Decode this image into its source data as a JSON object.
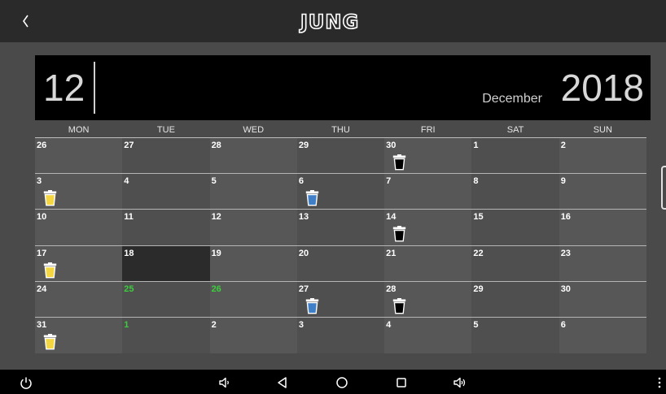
{
  "app": {
    "logo_text": "JUNG"
  },
  "header": {
    "day": "12",
    "month": "December",
    "year": "2018"
  },
  "weekdays": [
    "MON",
    "TUE",
    "WED",
    "THU",
    "FRI",
    "SAT",
    "SUN"
  ],
  "colors": {
    "bin_yellow": "#f3d641",
    "bin_blue": "#3f7fc8",
    "bin_black": "#000000",
    "holiday_green": "#3dcc3d"
  },
  "weeks": [
    [
      {
        "d": "26"
      },
      {
        "d": "27"
      },
      {
        "d": "28"
      },
      {
        "d": "29"
      },
      {
        "d": "30",
        "bin": "black"
      },
      {
        "d": "1"
      },
      {
        "d": "2"
      }
    ],
    [
      {
        "d": "3",
        "bin": "yellow"
      },
      {
        "d": "4"
      },
      {
        "d": "5"
      },
      {
        "d": "6",
        "bin": "blue"
      },
      {
        "d": "7"
      },
      {
        "d": "8"
      },
      {
        "d": "9"
      }
    ],
    [
      {
        "d": "10"
      },
      {
        "d": "11"
      },
      {
        "d": "12"
      },
      {
        "d": "13"
      },
      {
        "d": "14",
        "bin": "black"
      },
      {
        "d": "15"
      },
      {
        "d": "16"
      }
    ],
    [
      {
        "d": "17",
        "bin": "yellow"
      },
      {
        "d": "18",
        "today": true
      },
      {
        "d": "19"
      },
      {
        "d": "20"
      },
      {
        "d": "21"
      },
      {
        "d": "22"
      },
      {
        "d": "23"
      }
    ],
    [
      {
        "d": "24"
      },
      {
        "d": "25",
        "holiday": true
      },
      {
        "d": "26",
        "holiday": true
      },
      {
        "d": "27",
        "bin": "blue"
      },
      {
        "d": "28",
        "bin": "black"
      },
      {
        "d": "29"
      },
      {
        "d": "30"
      }
    ],
    [
      {
        "d": "31",
        "bin": "yellow"
      },
      {
        "d": "1",
        "holiday": true
      },
      {
        "d": "2"
      },
      {
        "d": "3"
      },
      {
        "d": "4"
      },
      {
        "d": "5"
      },
      {
        "d": "6"
      }
    ]
  ],
  "nav_icons": [
    "power-icon",
    "volume-down-icon",
    "back-triangle-icon",
    "home-circle-icon",
    "recents-square-icon",
    "volume-up-icon",
    "more-vert-icon"
  ]
}
